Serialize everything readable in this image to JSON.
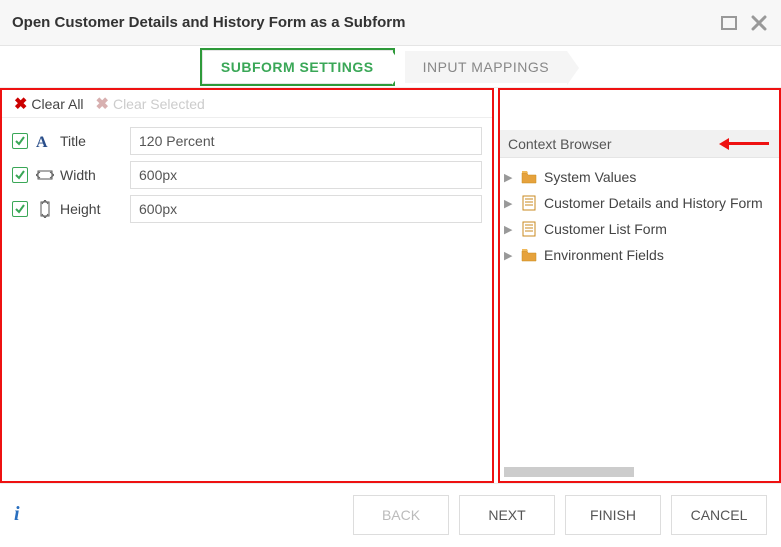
{
  "header": {
    "title": "Open Customer Details and History Form as a Subform"
  },
  "tabs": {
    "settings": "SUBFORM SETTINGS",
    "mappings": "INPUT MAPPINGS"
  },
  "toolbar": {
    "clear_all": "Clear All",
    "clear_selected": "Clear Selected"
  },
  "settings": {
    "title_label": "Title",
    "title_value": "120 Percent",
    "width_label": "Width",
    "width_value": "600px",
    "height_label": "Height",
    "height_value": "600px"
  },
  "context": {
    "header": "Context Browser",
    "items": [
      {
        "icon": "folder",
        "label": "System Values"
      },
      {
        "icon": "form",
        "label": "Customer Details and History Form"
      },
      {
        "icon": "form",
        "label": "Customer List Form"
      },
      {
        "icon": "folder",
        "label": "Environment Fields"
      }
    ]
  },
  "footer": {
    "back": "BACK",
    "next": "NEXT",
    "finish": "FINISH",
    "cancel": "CANCEL"
  }
}
